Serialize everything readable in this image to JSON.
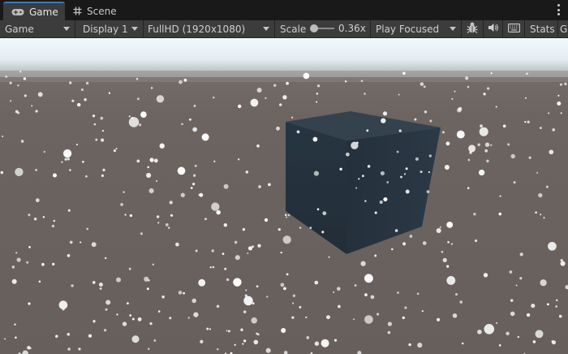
{
  "tabs": [
    {
      "label": "Game",
      "icon": "gamepad-icon",
      "active": true
    },
    {
      "label": "Scene",
      "icon": "grid-icon",
      "active": false
    }
  ],
  "toolbar": {
    "view_mode": "Game",
    "display": "Display 1",
    "resolution": "FullHD (1920x1080)",
    "scale_label": "Scale",
    "scale_value": "0.36x",
    "play_mode": "Play Focused",
    "stats_label": "Stats",
    "gizmos_label": "G"
  },
  "icons": {
    "debug": "bug-icon",
    "audio": "speaker-icon",
    "keyboard": "keyboard-icon",
    "more": "more-vertical-icon"
  },
  "colors": {
    "accent": "#3a79bb",
    "toolbar_bg": "#3c3c3c",
    "panel_bg": "#191919",
    "ground": "#6a6360",
    "sky": "#eef6fb",
    "cube_front": "#26323d",
    "cube_top": "#34424e",
    "snow": "#ffffff"
  }
}
